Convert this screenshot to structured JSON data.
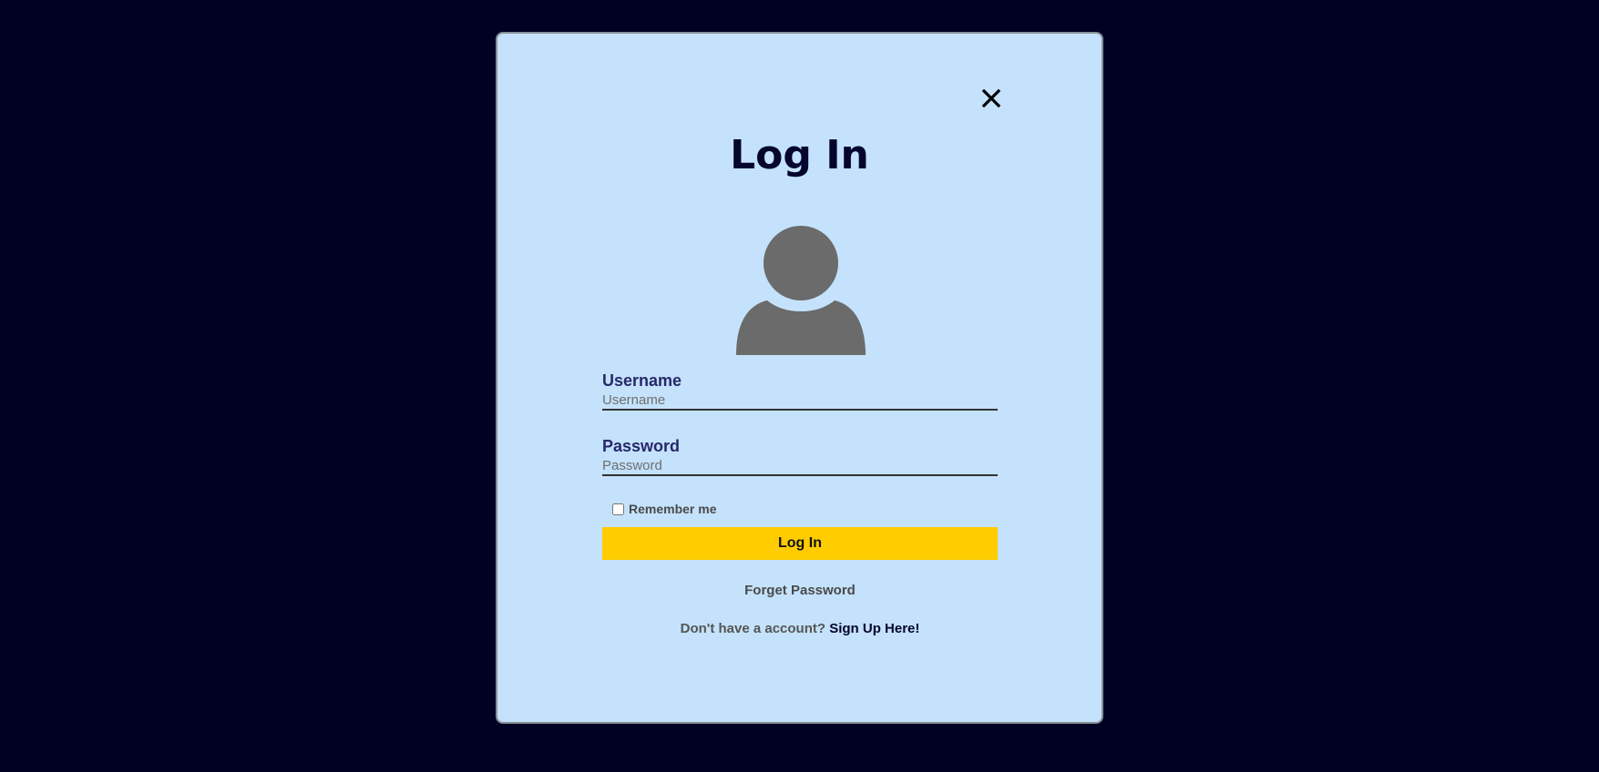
{
  "colors": {
    "page_background": "#010124",
    "modal_background": "#c4e2fb",
    "title": "#05052e",
    "label": "#27286a",
    "button_background": "#ffcc00",
    "avatar": "#6b6b6b"
  },
  "modal": {
    "close_icon": "close-icon",
    "title": "Log In",
    "avatar_icon": "user-avatar-icon"
  },
  "form": {
    "username": {
      "label": "Username",
      "value": "",
      "placeholder": "Username"
    },
    "password": {
      "label": "Password",
      "value": "",
      "placeholder": "Password"
    },
    "remember": {
      "label": "Remember me",
      "checked": false
    },
    "submit_label": "Log In",
    "forgot_label": "Forget Password",
    "signup_prompt": "Don't have a account?",
    "signup_link": "Sign Up Here!"
  }
}
